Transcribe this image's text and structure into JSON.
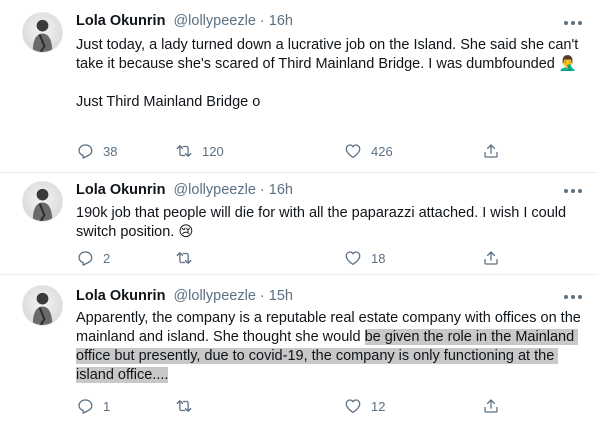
{
  "tweets": [
    {
      "name": "Lola Okunrin",
      "handle": "@lollypeezle",
      "separator": "·",
      "time": "16h",
      "text": "Just today, a lady turned down a lucrative job on the Island. She said she can't take it because she's scared of Third Mainland Bridge. I was dumbfounded 🤦‍♂️\n\nJust Third Mainland Bridge o",
      "replies": "38",
      "retweets": "120",
      "likes": "426"
    },
    {
      "name": "Lola Okunrin",
      "handle": "@lollypeezle",
      "separator": "·",
      "time": "16h",
      "text": "190k job that people will die for with all the paparazzi attached. I wish I could switch position. 😢",
      "replies": "2",
      "retweets": "",
      "likes": "18"
    },
    {
      "name": "Lola Okunrin",
      "handle": "@lollypeezle",
      "separator": "·",
      "time": "15h",
      "text_plain": "Apparently, the company is a reputable real estate company with offices on the mainland and island. She thought she would ",
      "text_highlighted": "be given the role in the Mainland office but presently, due to covid-19, the company is only functioning at the island office....",
      "replies": "1",
      "retweets": "",
      "likes": "12"
    }
  ],
  "colors": {
    "text": "#0f1419",
    "muted": "#5b7083",
    "highlight": "#c8c8c8",
    "divider": "#ebeef0"
  },
  "icons": [
    "more-icon",
    "reply-icon",
    "retweet-icon",
    "like-icon",
    "share-icon"
  ]
}
